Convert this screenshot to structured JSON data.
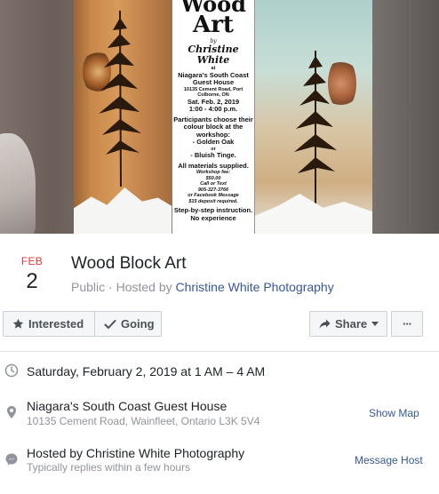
{
  "cover": {
    "poster": {
      "title_line_1": "Wood",
      "title_line_2": "Art",
      "by": "by",
      "author": "Christine White",
      "at": "at",
      "venue": "Niagara's South Coast Guest House",
      "address": "10135 Cement Road, Port Colborne, ON",
      "date": "Sat. Feb. 2, 2019",
      "time": "1:00 - 4:00 p.m.",
      "participants": "Participants choose their colour block at the workshop:",
      "option_1": "- Golden Oak",
      "or": "or",
      "option_2": "- Bluish Tinge.",
      "materials": "All materials supplied.",
      "fee_label": "Workshop fee:",
      "fee": "$50.00",
      "call": "Call or Text",
      "phone": "905-327-3766",
      "facebook": "or Facebook Message",
      "deposit": "$15 deposit required.",
      "instruction": "Step-by-step instruction.",
      "experience": "No experience"
    }
  },
  "event": {
    "month": "FEB",
    "day": "2",
    "title": "Wood Block Art",
    "privacy": "Public",
    "separator": " · Hosted by ",
    "host_link": "Christine White Photography"
  },
  "actions": {
    "interested": "Interested",
    "going": "Going",
    "share": "Share",
    "more": "···"
  },
  "details": {
    "datetime": "Saturday, February 2, 2019 at 1 AM – 4 AM",
    "location_name": "Niagara's South Coast Guest House",
    "location_address": "10135 Cement Road, Wainfleet, Ontario L3K 5V4",
    "show_map": "Show Map",
    "host_line": "Hosted by Christine White Photography",
    "host_reply": "Typically replies within a few hours",
    "message_host": "Message Host"
  },
  "colors": {
    "link": "#365899",
    "month": "#d93b3b",
    "muted": "#90949c",
    "button_bg": "#f5f6f7"
  },
  "icons": [
    "star-icon",
    "check-icon",
    "share-arrow-icon",
    "more-dots-icon",
    "clock-icon",
    "location-pin-icon",
    "messenger-icon"
  ]
}
